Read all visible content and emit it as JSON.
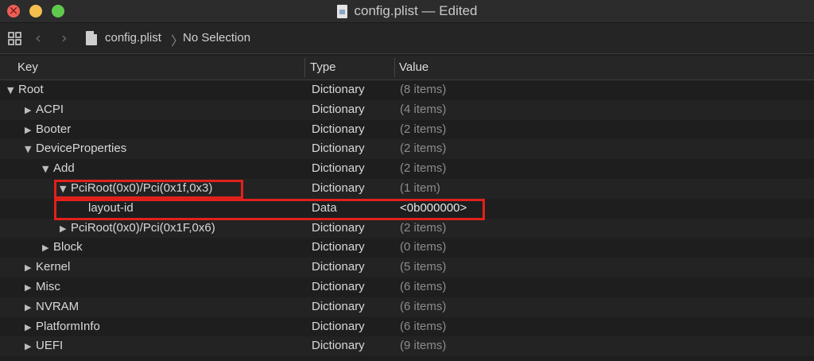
{
  "window": {
    "title": "config.plist — Edited",
    "doc_icon": "plist-document-icon"
  },
  "toolbar": {
    "grid_icon": "grid-icon",
    "back_icon": "chevron-left-icon",
    "forward_icon": "chevron-right-icon",
    "breadcrumb_file": "config.plist",
    "breadcrumb_separator": "〉",
    "breadcrumb_selection": "No Selection"
  },
  "columns": {
    "key": "Key",
    "type": "Type",
    "value": "Value"
  },
  "rows": [
    {
      "key": "Root",
      "type": "Dictionary",
      "value": "(8 items)",
      "depth": 0,
      "disclosure": "expanded"
    },
    {
      "key": "ACPI",
      "type": "Dictionary",
      "value": "(4 items)",
      "depth": 1,
      "disclosure": "collapsed"
    },
    {
      "key": "Booter",
      "type": "Dictionary",
      "value": "(2 items)",
      "depth": 1,
      "disclosure": "collapsed"
    },
    {
      "key": "DeviceProperties",
      "type": "Dictionary",
      "value": "(2 items)",
      "depth": 1,
      "disclosure": "expanded"
    },
    {
      "key": "Add",
      "type": "Dictionary",
      "value": "(2 items)",
      "depth": 2,
      "disclosure": "expanded"
    },
    {
      "key": "PciRoot(0x0)/Pci(0x1f,0x3)",
      "type": "Dictionary",
      "value": "(1 item)",
      "depth": 3,
      "disclosure": "expanded"
    },
    {
      "key": "layout-id",
      "type": "Data",
      "value": "<0b000000>",
      "depth": 4,
      "disclosure": "none"
    },
    {
      "key": "PciRoot(0x0)/Pci(0x1F,0x6)",
      "type": "Dictionary",
      "value": "(2 items)",
      "depth": 3,
      "disclosure": "collapsed"
    },
    {
      "key": "Block",
      "type": "Dictionary",
      "value": "(0 items)",
      "depth": 2,
      "disclosure": "collapsed"
    },
    {
      "key": "Kernel",
      "type": "Dictionary",
      "value": "(5 items)",
      "depth": 1,
      "disclosure": "collapsed"
    },
    {
      "key": "Misc",
      "type": "Dictionary",
      "value": "(6 items)",
      "depth": 1,
      "disclosure": "collapsed"
    },
    {
      "key": "NVRAM",
      "type": "Dictionary",
      "value": "(6 items)",
      "depth": 1,
      "disclosure": "collapsed"
    },
    {
      "key": "PlatformInfo",
      "type": "Dictionary",
      "value": "(6 items)",
      "depth": 1,
      "disclosure": "collapsed"
    },
    {
      "key": "UEFI",
      "type": "Dictionary",
      "value": "(9 items)",
      "depth": 1,
      "disclosure": "collapsed"
    }
  ],
  "colors": {
    "highlight_box": "#e0211b",
    "background": "#1e1e1e"
  }
}
